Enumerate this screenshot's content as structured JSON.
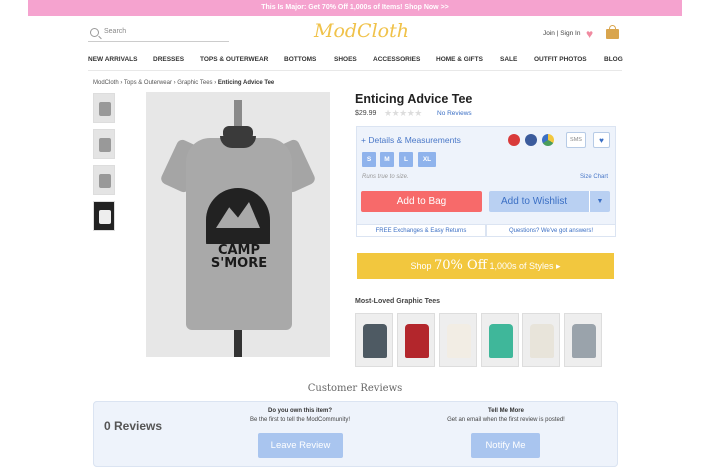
{
  "banner": {
    "text": "This Is Major: Get 70% Off 1,000s of Items! Shop Now >>"
  },
  "header": {
    "search_placeholder": "Search",
    "logo": "ModCloth",
    "account": "Join | Sign In"
  },
  "nav": [
    "NEW ARRIVALS",
    "DRESSES",
    "TOPS & OUTERWEAR",
    "BOTTOMS",
    "SHOES",
    "ACCESSORIES",
    "HOME & GIFTS",
    "SALE",
    "OUTFIT PHOTOS",
    "BLOG"
  ],
  "breadcrumb": [
    "ModCloth",
    "Tops & Outerwear",
    "Graphic Tees",
    "Enticing Advice Tee"
  ],
  "product": {
    "title": "Enticing Advice Tee",
    "price": "$29.99",
    "rating": 0,
    "rating_max": 5,
    "no_reviews": "No Reviews",
    "graphic_text": "CAMP S'MORE",
    "details": "+ Details & Measurements",
    "sms_label": "SMS",
    "sizes": [
      "S",
      "M",
      "L",
      "XL"
    ],
    "fit_note": "Runs true to size.",
    "size_chart": "Size Chart",
    "add_to_bag": "Add to Bag",
    "add_to_wishlist": "Add to Wishlist",
    "free_exchanges": "FREE Exchanges & Easy Returns",
    "questions": "Questions? We've got answers!"
  },
  "promo": {
    "prefix": "Shop",
    "highlight": "70% Off",
    "suffix": "1,000s of Styles ▸"
  },
  "most_loved": {
    "title": "Most-Loved Graphic Tees"
  },
  "reviews": {
    "title": "Customer Reviews",
    "count": "0 Reviews",
    "own_q": "Do you own this item?",
    "own_sub": "Be the first to tell the ModCommunity!",
    "leave_review": "Leave Review",
    "tell_q": "Tell Me More",
    "tell_sub": "Get an email when the first review is posted!",
    "notify": "Notify Me"
  },
  "colors": {
    "banner": "#f5a3cf",
    "bag_button": "#f76a6a",
    "wishlist": "#b9d0f2",
    "promo": "#f2c73e",
    "link": "#3b6fc4"
  }
}
